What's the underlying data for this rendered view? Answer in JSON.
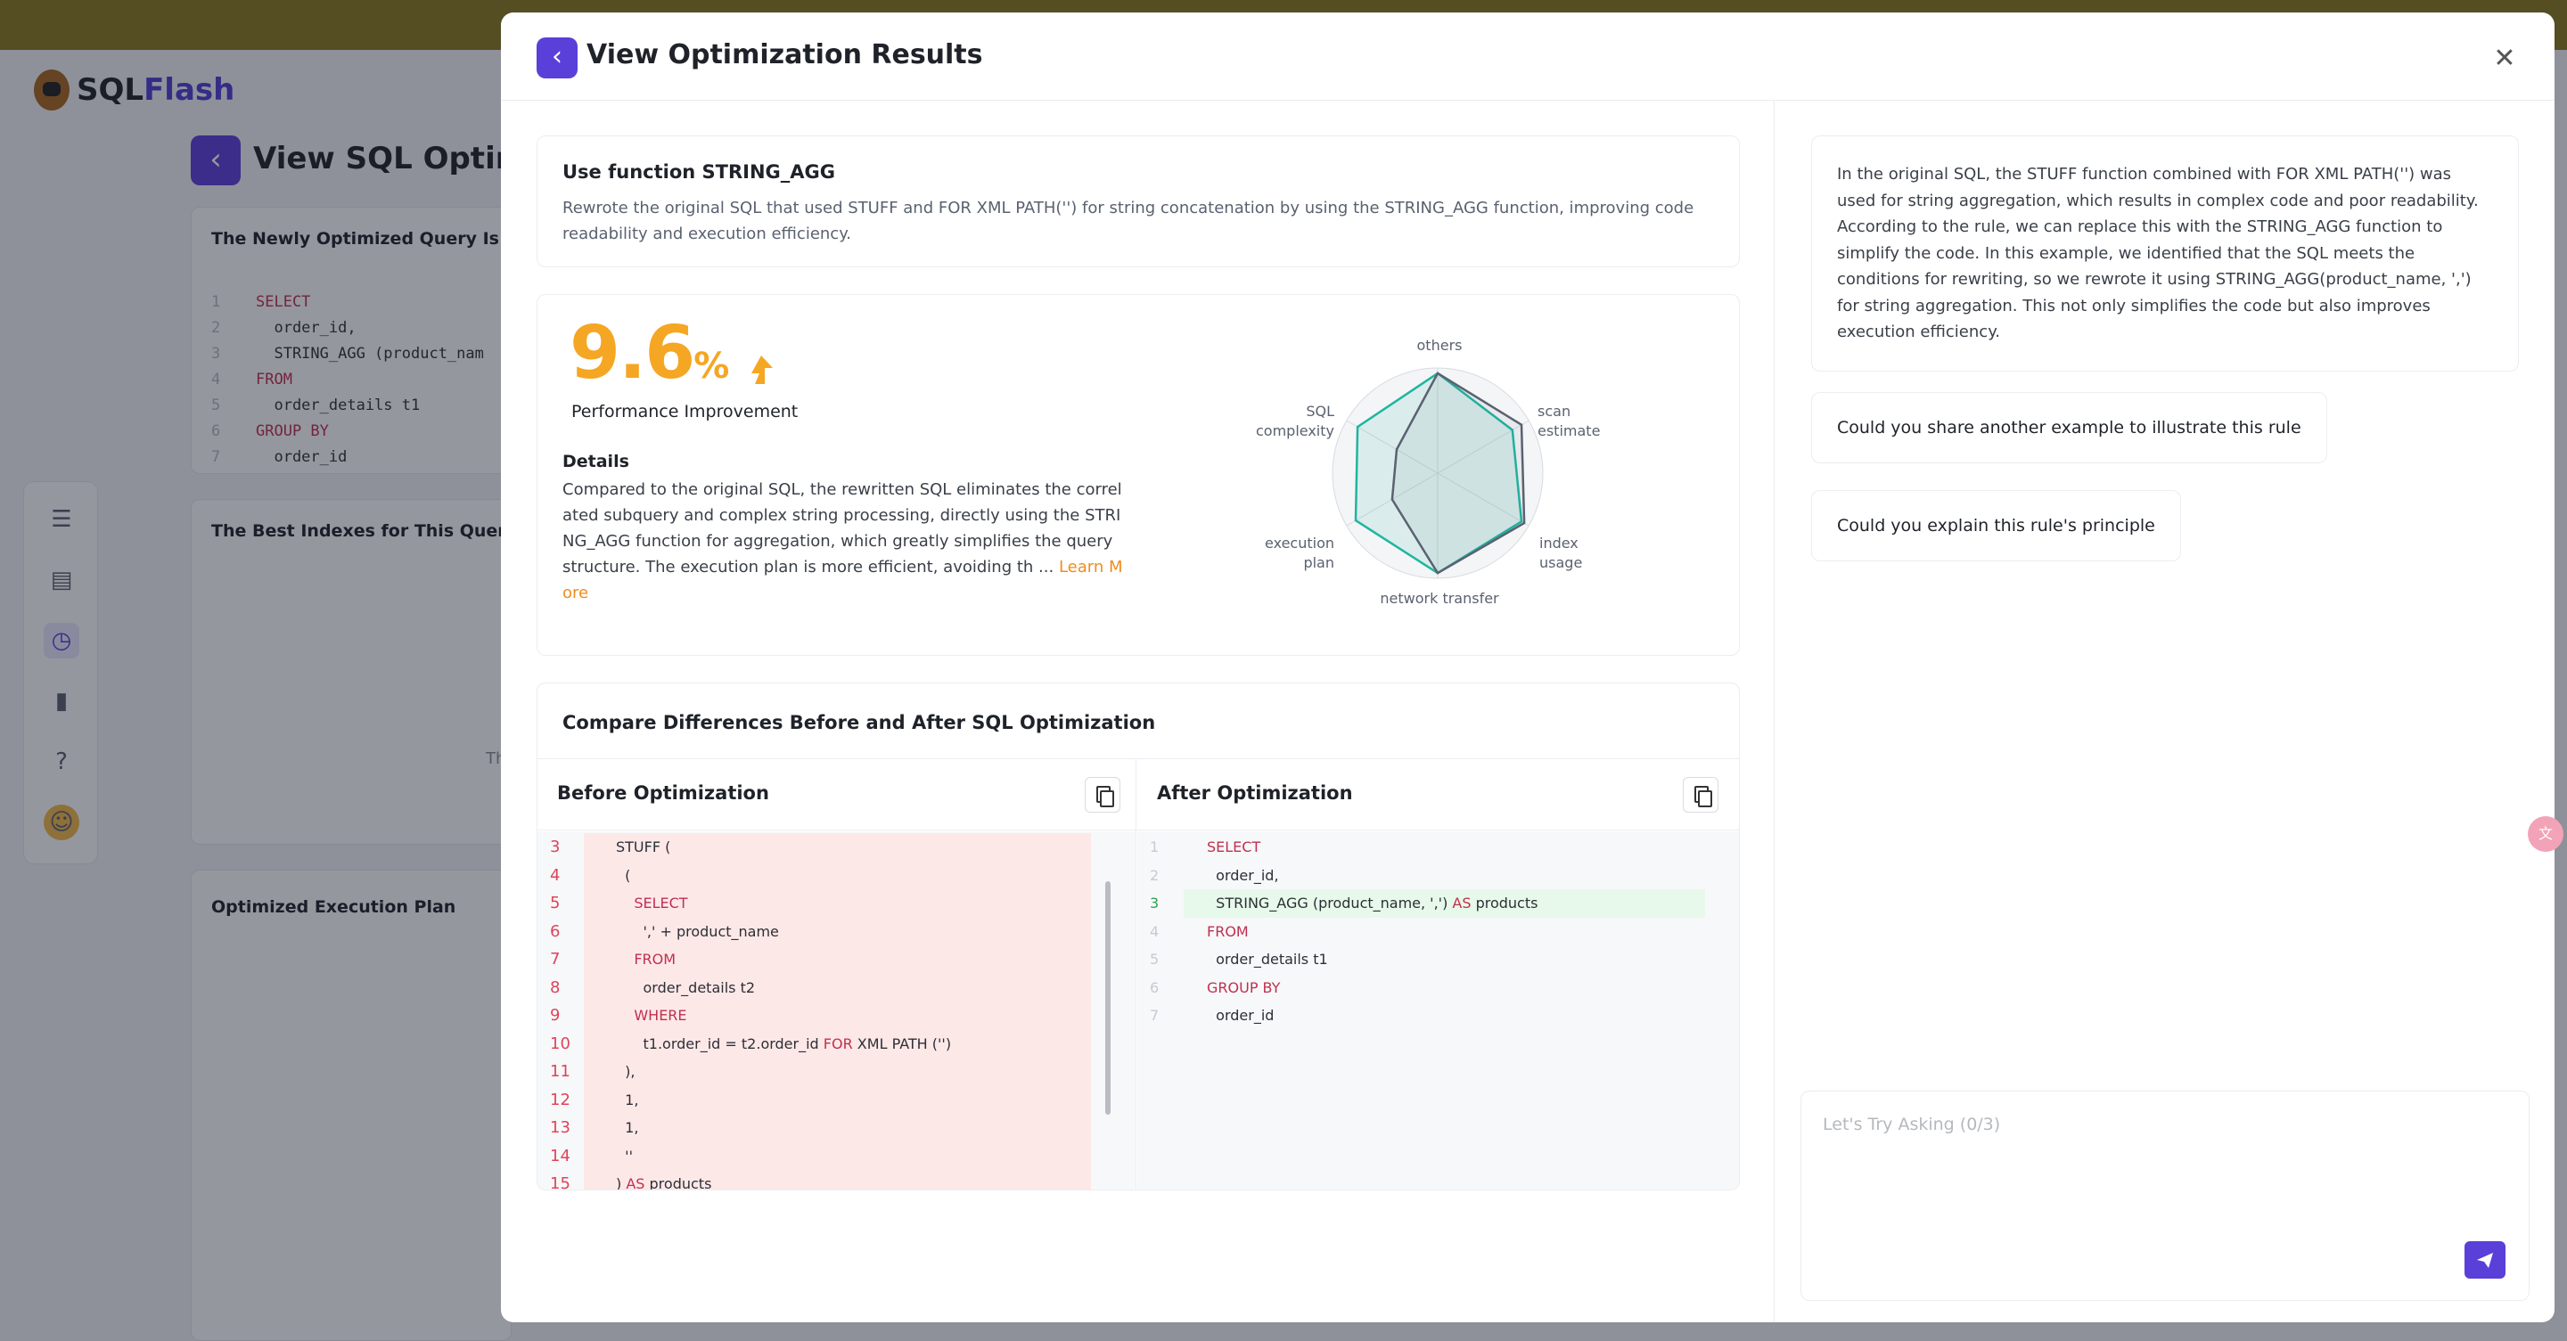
{
  "background": {
    "logo_prefix": "SQL",
    "logo_suffix": "Flash",
    "page_title": "View SQL Optimiza",
    "card1_title": "The Newly Optimized Query Is",
    "card1_code": [
      {
        "n": "1",
        "t": "SELECT",
        "kw": true
      },
      {
        "n": "2",
        "t": "  order_id,",
        "kw": false
      },
      {
        "n": "3",
        "t": "  STRING_AGG (product_nam",
        "kw": false
      },
      {
        "n": "4",
        "t": "FROM",
        "kw": true
      },
      {
        "n": "5",
        "t": "  order_details t1",
        "kw": false
      },
      {
        "n": "6",
        "t": "GROUP BY",
        "kw": true
      },
      {
        "n": "7",
        "t": "  order_id",
        "kw": false
      }
    ],
    "card2_title": "The Best Indexes for This Query Are",
    "card2_fragment": "Th",
    "card3_title": "Optimized Execution Plan"
  },
  "modal": {
    "title": "View Optimization Results",
    "rule": {
      "title": "Use function STRING_AGG",
      "description": "Rewrote the original SQL that used STUFF and FOR XML PATH('') for string concatenation by using the STRING_AGG function, improving code readability and execution efficiency."
    },
    "performance": {
      "value": "9.6",
      "unit": "%",
      "label": "Performance Improvement",
      "details_title": "Details",
      "details_text": "Compared to the original SQL, the rewritten SQL eliminates the correlated subquery and complex string processing, directly using the STRING_AGG function for aggregation, which greatly simplifies the query structure. The execution plan is more efficient, avoiding th ...",
      "learn_more": "Learn More"
    },
    "radar": {
      "axes": [
        "others",
        "scan estimate",
        "index usage",
        "network transfer",
        "execution plan",
        "SQL complexity"
      ],
      "labels": {
        "others": "others",
        "scan_1": "scan",
        "scan_2": "estimate",
        "index_1": "index",
        "index_2": "usage",
        "network": "network transfer",
        "exec_1": "execution",
        "exec_2": "plan",
        "sql_1": "SQL",
        "sql_2": "complexity"
      },
      "series": [
        {
          "color": "#1fb5a0",
          "values": [
            0.95,
            0.82,
            0.92,
            0.95,
            0.9,
            0.88
          ]
        },
        {
          "color": "#5a6170",
          "values": [
            0.95,
            0.92,
            0.95,
            0.95,
            0.5,
            0.45
          ]
        }
      ]
    },
    "compare": {
      "title": "Compare Differences Before and After SQL Optimization",
      "before_title": "Before Optimization",
      "after_title": "After Optimization",
      "before_lines": [
        {
          "n": "3",
          "t": "STUFF (",
          "kw": null
        },
        {
          "n": "4",
          "t": "  (",
          "kw": null
        },
        {
          "n": "5",
          "t": "    SELECT",
          "kw": "all"
        },
        {
          "n": "6",
          "t": "      ',' + product_name",
          "kw": null
        },
        {
          "n": "7",
          "t": "    FROM",
          "kw": "all"
        },
        {
          "n": "8",
          "t": "      order_details t2",
          "kw": null
        },
        {
          "n": "9",
          "t": "    WHERE",
          "kw": "all"
        },
        {
          "n": "10",
          "t": "      t1.order_id = t2.order_id FOR XML PATH ('')",
          "kw": "FOR"
        },
        {
          "n": "11",
          "t": "  ),",
          "kw": null
        },
        {
          "n": "12",
          "t": "  1,",
          "kw": null
        },
        {
          "n": "13",
          "t": "  1,",
          "kw": null
        },
        {
          "n": "14",
          "t": "  ''",
          "kw": null
        },
        {
          "n": "15",
          "t": ") AS products",
          "kw": "AS"
        }
      ],
      "after_lines": [
        {
          "n": "1",
          "t": "SELECT",
          "kw": "all",
          "added": false
        },
        {
          "n": "2",
          "t": "  order_id,",
          "kw": null,
          "added": false
        },
        {
          "n": "3",
          "t": "  STRING_AGG (product_name, ',') AS products",
          "kw": "AS",
          "added": true
        },
        {
          "n": "4",
          "t": "FROM",
          "kw": "all",
          "added": false
        },
        {
          "n": "5",
          "t": "  order_details t1",
          "kw": null,
          "added": false
        },
        {
          "n": "6",
          "t": "GROUP BY",
          "kw": "all",
          "added": false
        },
        {
          "n": "7",
          "t": "  order_id",
          "kw": null,
          "added": false
        }
      ]
    },
    "chat": {
      "answer": "In the original SQL, the STUFF function combined with FOR XML PATH('') was used for string aggregation, which results in complex code and poor readability. According to the rule, we can replace this with the STRING_AGG function to simplify the code. In this example, we identified that the SQL meets the conditions for rewriting, so we rewrote it using STRING_AGG(product_name, ',') for string aggregation. This not only simplifies the code but also improves execution efficiency.",
      "suggestions": [
        "Could you share another example to illustrate this rule",
        "Could you explain this rule's principle"
      ],
      "input_placeholder": "Let's Try Asking (0/3)",
      "input_value": ""
    }
  },
  "colors": {
    "brand": "#5b3fd9",
    "accent": "#f5a623",
    "removed_bg": "#fde8e8",
    "added_bg": "#e6f9ea"
  },
  "icons": [
    "chevron-left-icon",
    "close-icon",
    "arrow-up-icon",
    "copy-icon",
    "send-icon",
    "list-icon",
    "document-icon",
    "history-icon",
    "bookmark-icon",
    "help-icon",
    "avatar-icon"
  ]
}
